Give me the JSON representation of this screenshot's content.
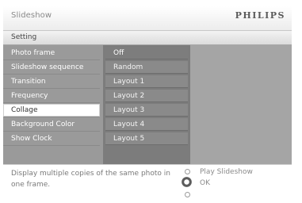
{
  "header": {
    "title": "Slideshow",
    "brand": "PHILIPS"
  },
  "section": {
    "title": "Setting"
  },
  "menu": {
    "items": [
      {
        "label": "Photo frame"
      },
      {
        "label": "Slideshow sequence"
      },
      {
        "label": "Transition"
      },
      {
        "label": "Frequency"
      },
      {
        "label": "Collage"
      },
      {
        "label": "Background Color"
      },
      {
        "label": "Show Clock"
      }
    ],
    "selected": "Collage"
  },
  "options": {
    "items": [
      {
        "label": "Off"
      },
      {
        "label": "Random"
      },
      {
        "label": "Layout 1"
      },
      {
        "label": "Layout 2"
      },
      {
        "label": "Layout 3"
      },
      {
        "label": "Layout 4"
      },
      {
        "label": "Layout 5"
      }
    ],
    "current": "Off"
  },
  "footer": {
    "help": "Display multiple copies of the same photo in one frame.",
    "play_label": "Play Slideshow",
    "ok_label": "OK"
  },
  "icons": {
    "nav_up": "nav-up-circle",
    "nav_ok": "ok-button-ring",
    "nav_down": "nav-down-circle"
  }
}
